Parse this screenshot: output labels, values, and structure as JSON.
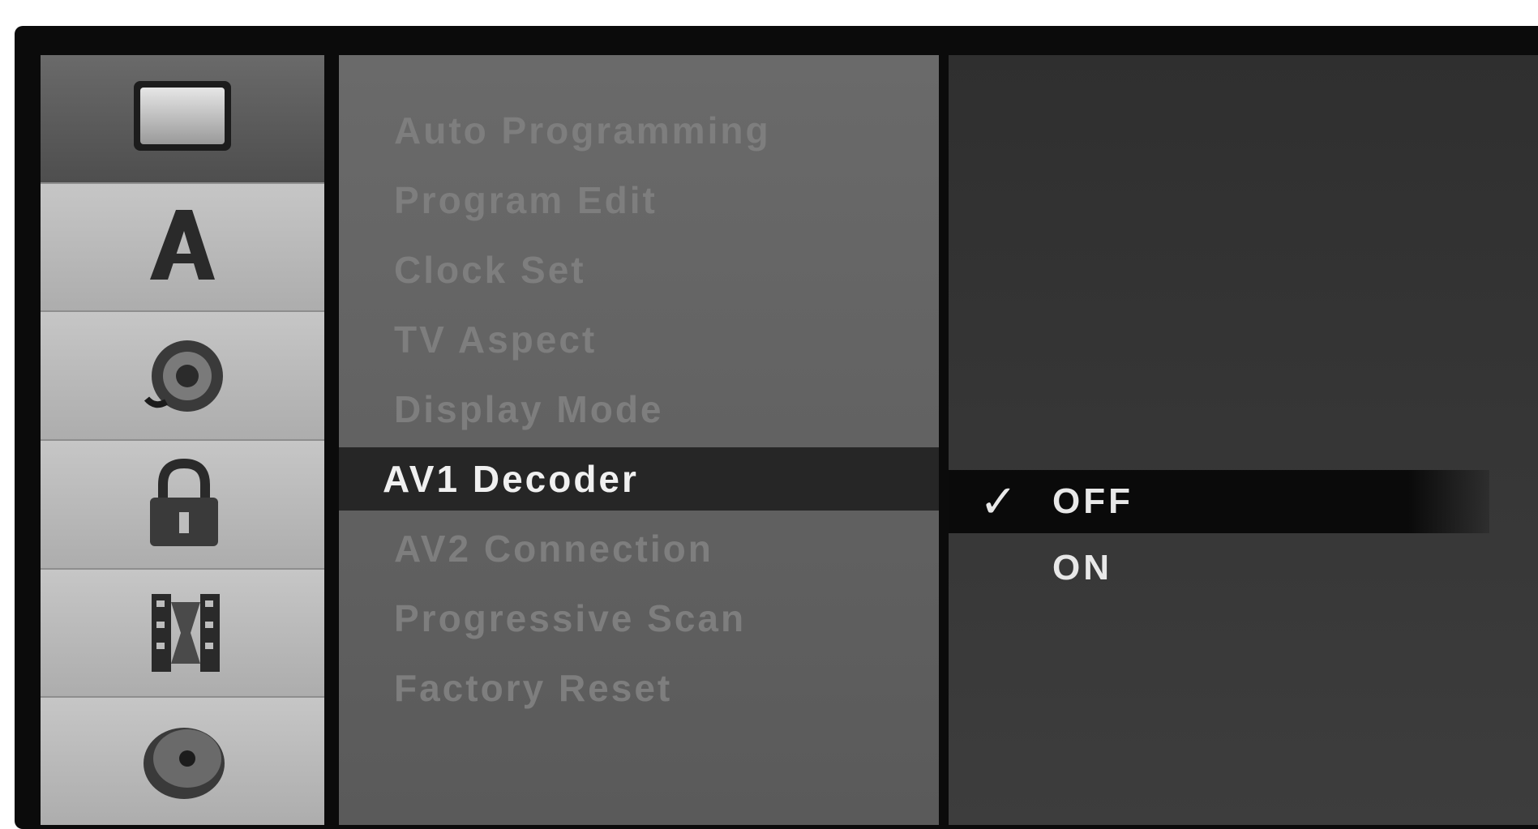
{
  "sidebar": {
    "items": [
      {
        "icon": "tv-screen-icon",
        "active": true
      },
      {
        "icon": "language-a-icon",
        "active": false
      },
      {
        "icon": "speaker-icon",
        "active": false
      },
      {
        "icon": "padlock-icon",
        "active": false
      },
      {
        "icon": "film-reel-icon",
        "active": false
      },
      {
        "icon": "disc-icon",
        "active": false
      }
    ]
  },
  "menu": {
    "items": [
      {
        "label": "Auto Programming"
      },
      {
        "label": "Program Edit"
      },
      {
        "label": "Clock Set"
      },
      {
        "label": "TV Aspect"
      },
      {
        "label": "Display Mode"
      },
      {
        "label": "AV1 Decoder",
        "selected": true
      },
      {
        "label": "AV2 Connection"
      },
      {
        "label": "Progressive Scan"
      },
      {
        "label": "Factory Reset"
      }
    ]
  },
  "options": {
    "items": [
      {
        "label": "OFF",
        "checked": true
      },
      {
        "label": "ON",
        "checked": false
      }
    ]
  },
  "colors": {
    "selected_row": "#262626",
    "menu_panel": "#5f5f5f",
    "options_panel": "#353535",
    "sidebar": "#bdbdbd"
  }
}
